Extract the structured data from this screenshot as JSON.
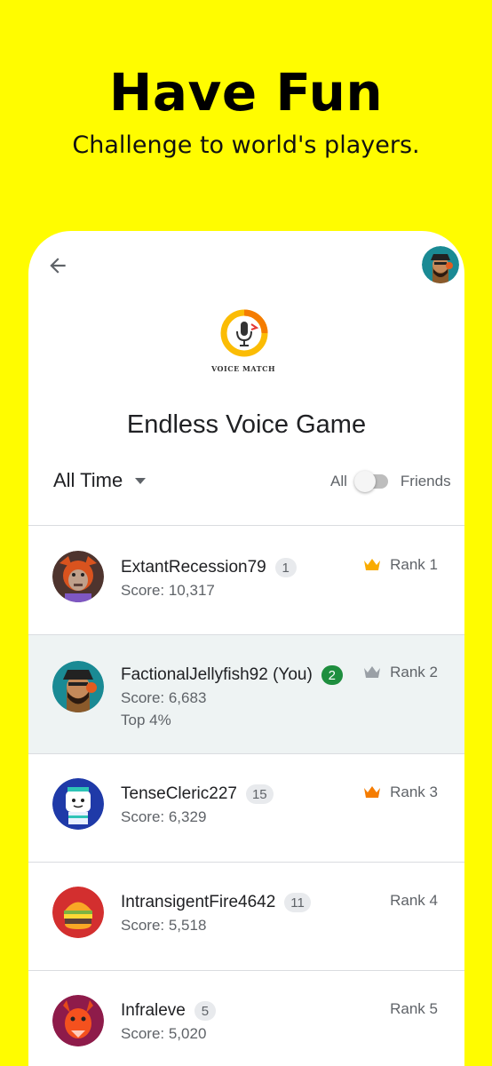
{
  "promo": {
    "title": "Have Fun",
    "subtitle": "Challenge to world's players."
  },
  "header": {
    "back_icon": "arrow-back-icon",
    "avatar_icon": "pirate-avatar"
  },
  "logo": {
    "text": "VOICE MATCH",
    "icon": "microphone-icon"
  },
  "game_title": "Endless Voice Game",
  "filter": {
    "selected": "All Time"
  },
  "toggle": {
    "left_label": "All",
    "right_label": "Friends",
    "state": "all"
  },
  "colors": {
    "background": "#FFFC00",
    "gold_crown": "#F9AB00",
    "silver_crown": "#9AA0A6",
    "bronze_crown": "#F57C00",
    "you_badge": "#1E8E3E",
    "highlight_row": "#EEF3F3"
  },
  "leaderboard": [
    {
      "name": "ExtantRecession79",
      "badge": "1",
      "score": "Score: 10,317",
      "rank": "Rank 1",
      "crown": "gold",
      "avatar": "orange-wolf-avatar"
    },
    {
      "name": "FactionalJellyfish92 (You)",
      "badge": "2",
      "score": "Score: 6,683",
      "top": "Top 4%",
      "rank": "Rank 2",
      "crown": "silver",
      "avatar": "pirate-avatar",
      "is_you": true
    },
    {
      "name": "TenseCleric227",
      "badge": "15",
      "score": "Score: 6,329",
      "rank": "Rank 3",
      "crown": "bronze",
      "avatar": "robot-avatar"
    },
    {
      "name": "IntransigentFire4642",
      "badge": "11",
      "score": "Score: 5,518",
      "rank": "Rank 4",
      "avatar": "burger-avatar"
    },
    {
      "name": "Infraleve",
      "badge": "5",
      "score": "Score: 5,020",
      "rank": "Rank 5",
      "avatar": "dragon-avatar"
    }
  ]
}
